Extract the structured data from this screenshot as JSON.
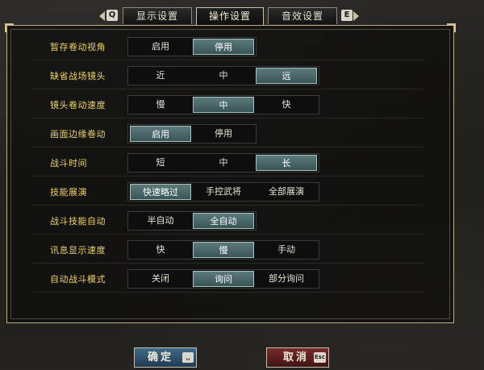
{
  "tabs": {
    "prev_key": "Q",
    "next_key": "E",
    "items": [
      {
        "label": "显示设置"
      },
      {
        "label": "操作设置"
      },
      {
        "label": "音效设置"
      }
    ]
  },
  "settings": [
    {
      "label": "暂存卷动视角",
      "options": [
        "启用",
        "停用"
      ],
      "selected": 1
    },
    {
      "label": "缺省战场镜头",
      "options": [
        "近",
        "中",
        "远"
      ],
      "selected": 2
    },
    {
      "label": "镜头卷动速度",
      "options": [
        "慢",
        "中",
        "快"
      ],
      "selected": 1
    },
    {
      "label": "画面边缘卷动",
      "options": [
        "启用",
        "停用"
      ],
      "selected": 0
    },
    {
      "label": "战斗时间",
      "options": [
        "短",
        "中",
        "长"
      ],
      "selected": 2
    },
    {
      "label": "技能展演",
      "options": [
        "快速略过",
        "手控武将",
        "全部展演"
      ],
      "selected": 0
    },
    {
      "label": "战斗技能自动",
      "options": [
        "半自动",
        "全自动"
      ],
      "selected": 1
    },
    {
      "label": "讯息显示速度",
      "options": [
        "快",
        "慢",
        "手动"
      ],
      "selected": 1
    },
    {
      "label": "自动战斗模式",
      "options": [
        "关闭",
        "询问",
        "部分询问"
      ],
      "selected": 1
    }
  ],
  "buttons": {
    "confirm_label": "确定",
    "confirm_key": "␣",
    "cancel_label": "取消",
    "cancel_key": "Esc"
  },
  "colors": {
    "label": "#f0d36a",
    "selected": "#4a6b6c",
    "frame": "#b9ae84"
  }
}
